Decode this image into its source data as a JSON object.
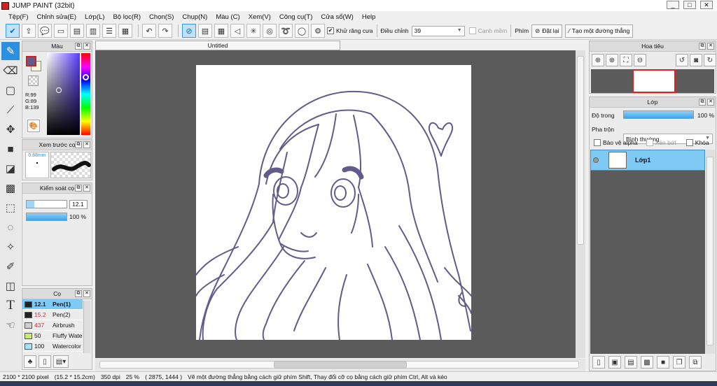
{
  "window": {
    "title": "JUMP PAINT (32bit)",
    "min": "_",
    "max": "□",
    "close": "✕"
  },
  "menu": [
    "Tệp(F)",
    "Chỉnh sửa(E)",
    "Lớp(L)",
    "Bộ lọc(R)",
    "Chọn(S)",
    "Chụp(N)",
    "Màu (C)",
    "Xem(V)",
    "Công cụ(T)",
    "Cửa sổ(W)",
    "Help"
  ],
  "toolbar": {
    "antialias_label": "Khử răng cưa",
    "antialias_checked": true,
    "adjust_label": "Điều chỉnh",
    "adjust_value": "39",
    "edge_label": "Cạnh mềm",
    "key_label": "Phím",
    "reset_label": "Đặt lại",
    "straight_line_label": "Tạo một đường thẳng"
  },
  "color_panel": {
    "title": "Màu",
    "r": "R:99",
    "g": "G:89",
    "b": "B:139",
    "current_color": "#635b8b"
  },
  "preview_panel": {
    "title": "Xem trước cọ",
    "size": "0.88mm"
  },
  "control_panel": {
    "title": "Kiểm soát cọ",
    "size_value": "12.1",
    "opacity_value": "100 %"
  },
  "brush_panel": {
    "title": "Cọ",
    "items": [
      {
        "size": "12.1",
        "name": "Pen(1)",
        "color": "#222222",
        "selected": true
      },
      {
        "size": "15.2",
        "name": "Pen(2)",
        "color": "#222222",
        "selected": false
      },
      {
        "size": "437",
        "name": "Airbrush",
        "color": "#cfcfcf",
        "selected": false
      },
      {
        "size": "50",
        "name": "Fluffy Wate",
        "color": "#c7ec6a",
        "selected": false
      },
      {
        "size": "100",
        "name": "Watercolor",
        "color": "#a8e4f4",
        "selected": false
      }
    ]
  },
  "document": {
    "tab_title": "Untitled"
  },
  "navigator": {
    "title": "Hoa tiêu"
  },
  "layer_panel": {
    "title": "Lớp",
    "opacity_label": "Độ trong",
    "opacity_value": "100 %",
    "blend_label": "Pha trộn",
    "blend_value": "Bình thường",
    "protect_alpha": "Bảo vệ alpha",
    "clip": "Xén bớt",
    "lock": "Khóa",
    "layers": [
      {
        "name": "Lớp1"
      }
    ]
  },
  "status": {
    "canvas_size": "2100 * 2100 pixel",
    "size_cm": "(15.2 * 15.2cm)",
    "dpi": "350 dpi",
    "zoom": "25 %",
    "coords": "( 2875, 1444 )",
    "hint": "Vẽ một đường thẳng bằng cách giữ phím Shift, Thay đổi cỡ cọ bằng cách giữ phím Ctrl, Alt và kéo"
  },
  "colors": {
    "accent": "#2d8fe0",
    "canvas_bg": "#5b5b5b",
    "line": "#635b8b",
    "layer_sel": "#7fcaf5"
  }
}
